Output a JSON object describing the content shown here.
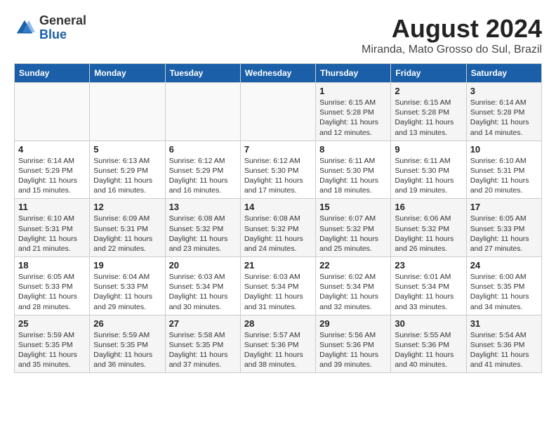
{
  "header": {
    "logo_general": "General",
    "logo_blue": "Blue",
    "main_title": "August 2024",
    "subtitle": "Miranda, Mato Grosso do Sul, Brazil"
  },
  "calendar": {
    "days_of_week": [
      "Sunday",
      "Monday",
      "Tuesday",
      "Wednesday",
      "Thursday",
      "Friday",
      "Saturday"
    ],
    "weeks": [
      [
        {
          "day": "",
          "info": ""
        },
        {
          "day": "",
          "info": ""
        },
        {
          "day": "",
          "info": ""
        },
        {
          "day": "",
          "info": ""
        },
        {
          "day": "1",
          "info": "Sunrise: 6:15 AM\nSunset: 5:28 PM\nDaylight: 11 hours\nand 12 minutes."
        },
        {
          "day": "2",
          "info": "Sunrise: 6:15 AM\nSunset: 5:28 PM\nDaylight: 11 hours\nand 13 minutes."
        },
        {
          "day": "3",
          "info": "Sunrise: 6:14 AM\nSunset: 5:28 PM\nDaylight: 11 hours\nand 14 minutes."
        }
      ],
      [
        {
          "day": "4",
          "info": "Sunrise: 6:14 AM\nSunset: 5:29 PM\nDaylight: 11 hours\nand 15 minutes."
        },
        {
          "day": "5",
          "info": "Sunrise: 6:13 AM\nSunset: 5:29 PM\nDaylight: 11 hours\nand 16 minutes."
        },
        {
          "day": "6",
          "info": "Sunrise: 6:12 AM\nSunset: 5:29 PM\nDaylight: 11 hours\nand 16 minutes."
        },
        {
          "day": "7",
          "info": "Sunrise: 6:12 AM\nSunset: 5:30 PM\nDaylight: 11 hours\nand 17 minutes."
        },
        {
          "day": "8",
          "info": "Sunrise: 6:11 AM\nSunset: 5:30 PM\nDaylight: 11 hours\nand 18 minutes."
        },
        {
          "day": "9",
          "info": "Sunrise: 6:11 AM\nSunset: 5:30 PM\nDaylight: 11 hours\nand 19 minutes."
        },
        {
          "day": "10",
          "info": "Sunrise: 6:10 AM\nSunset: 5:31 PM\nDaylight: 11 hours\nand 20 minutes."
        }
      ],
      [
        {
          "day": "11",
          "info": "Sunrise: 6:10 AM\nSunset: 5:31 PM\nDaylight: 11 hours\nand 21 minutes."
        },
        {
          "day": "12",
          "info": "Sunrise: 6:09 AM\nSunset: 5:31 PM\nDaylight: 11 hours\nand 22 minutes."
        },
        {
          "day": "13",
          "info": "Sunrise: 6:08 AM\nSunset: 5:32 PM\nDaylight: 11 hours\nand 23 minutes."
        },
        {
          "day": "14",
          "info": "Sunrise: 6:08 AM\nSunset: 5:32 PM\nDaylight: 11 hours\nand 24 minutes."
        },
        {
          "day": "15",
          "info": "Sunrise: 6:07 AM\nSunset: 5:32 PM\nDaylight: 11 hours\nand 25 minutes."
        },
        {
          "day": "16",
          "info": "Sunrise: 6:06 AM\nSunset: 5:32 PM\nDaylight: 11 hours\nand 26 minutes."
        },
        {
          "day": "17",
          "info": "Sunrise: 6:05 AM\nSunset: 5:33 PM\nDaylight: 11 hours\nand 27 minutes."
        }
      ],
      [
        {
          "day": "18",
          "info": "Sunrise: 6:05 AM\nSunset: 5:33 PM\nDaylight: 11 hours\nand 28 minutes."
        },
        {
          "day": "19",
          "info": "Sunrise: 6:04 AM\nSunset: 5:33 PM\nDaylight: 11 hours\nand 29 minutes."
        },
        {
          "day": "20",
          "info": "Sunrise: 6:03 AM\nSunset: 5:34 PM\nDaylight: 11 hours\nand 30 minutes."
        },
        {
          "day": "21",
          "info": "Sunrise: 6:03 AM\nSunset: 5:34 PM\nDaylight: 11 hours\nand 31 minutes."
        },
        {
          "day": "22",
          "info": "Sunrise: 6:02 AM\nSunset: 5:34 PM\nDaylight: 11 hours\nand 32 minutes."
        },
        {
          "day": "23",
          "info": "Sunrise: 6:01 AM\nSunset: 5:34 PM\nDaylight: 11 hours\nand 33 minutes."
        },
        {
          "day": "24",
          "info": "Sunrise: 6:00 AM\nSunset: 5:35 PM\nDaylight: 11 hours\nand 34 minutes."
        }
      ],
      [
        {
          "day": "25",
          "info": "Sunrise: 5:59 AM\nSunset: 5:35 PM\nDaylight: 11 hours\nand 35 minutes."
        },
        {
          "day": "26",
          "info": "Sunrise: 5:59 AM\nSunset: 5:35 PM\nDaylight: 11 hours\nand 36 minutes."
        },
        {
          "day": "27",
          "info": "Sunrise: 5:58 AM\nSunset: 5:35 PM\nDaylight: 11 hours\nand 37 minutes."
        },
        {
          "day": "28",
          "info": "Sunrise: 5:57 AM\nSunset: 5:36 PM\nDaylight: 11 hours\nand 38 minutes."
        },
        {
          "day": "29",
          "info": "Sunrise: 5:56 AM\nSunset: 5:36 PM\nDaylight: 11 hours\nand 39 minutes."
        },
        {
          "day": "30",
          "info": "Sunrise: 5:55 AM\nSunset: 5:36 PM\nDaylight: 11 hours\nand 40 minutes."
        },
        {
          "day": "31",
          "info": "Sunrise: 5:54 AM\nSunset: 5:36 PM\nDaylight: 11 hours\nand 41 minutes."
        }
      ]
    ]
  }
}
